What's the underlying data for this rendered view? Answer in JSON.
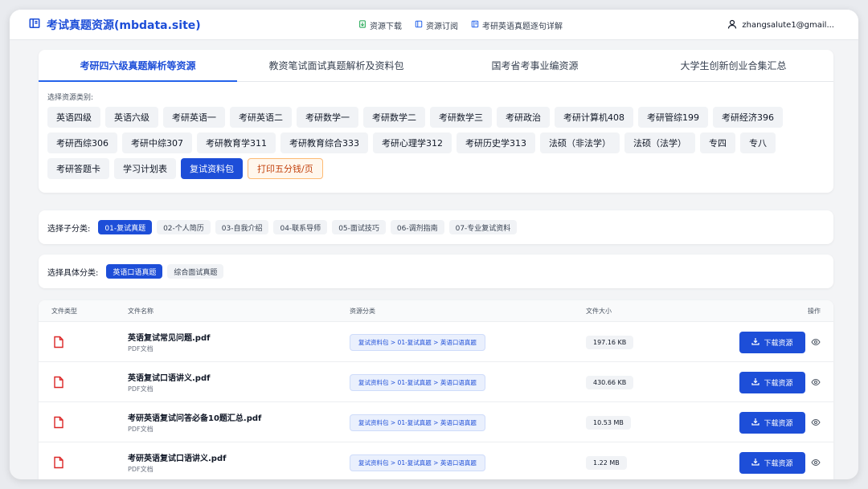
{
  "navbar": {
    "brand": "考试真题资源(mbdata.site)",
    "links": [
      "资源下载",
      "资源订阅",
      "考研英语真题逐句详解"
    ],
    "user": "zhangsalute1@gmail..."
  },
  "tabs": [
    "考研四六级真题解析等资源",
    "教资笔试面试真题解析及资料包",
    "国考省考事业编资源",
    "大学生创新创业合集汇总"
  ],
  "category_label": "选择资源类别:",
  "categories": [
    "英语四级",
    "英语六级",
    "考研英语一",
    "考研英语二",
    "考研数学一",
    "考研数学二",
    "考研数学三",
    "考研政治",
    "考研计算机408",
    "考研管综199",
    "考研经济396",
    "考研西综306",
    "考研中综307",
    "考研教育学311",
    "考研教育综合333",
    "考研心理学312",
    "考研历史学313",
    "法硕（非法学）",
    "法硕（法学）",
    "专四",
    "专八",
    "考研答题卡",
    "学习计划表",
    "复试资料包",
    "打印五分钱/页"
  ],
  "subcategory": {
    "label": "选择子分类:",
    "items": [
      "01-复试真题",
      "02-个人简历",
      "03-自我介绍",
      "04-联系导师",
      "05-面试技巧",
      "06-调剂指南",
      "07-专业复试资料"
    ]
  },
  "specific": {
    "label": "选择具体分类:",
    "items": [
      "英语口语真题",
      "综合面试真题"
    ]
  },
  "table": {
    "headers": [
      "文件类型",
      "文件名称",
      "资源分类",
      "文件大小",
      "操作"
    ],
    "download_label": "下载资源",
    "rows": [
      {
        "name": "英语复试常见问题.pdf",
        "type": "PDF文档",
        "path": "复试资料包 > 01-复试真题 > 英语口语真题",
        "size": "197.16 KB"
      },
      {
        "name": "英语复试口语讲义.pdf",
        "type": "PDF文档",
        "path": "复试资料包 > 01-复试真题 > 英语口语真题",
        "size": "430.66 KB"
      },
      {
        "name": "考研英语复试问答必备10题汇总.pdf",
        "type": "PDF文档",
        "path": "复试资料包 > 01-复试真题 > 英语口语真题",
        "size": "10.53 MB"
      },
      {
        "name": "考研英语复试口语讲义.pdf",
        "type": "PDF文档",
        "path": "复试资料包 > 01-复试真题 > 英语口语真题",
        "size": "1.22 MB"
      }
    ]
  },
  "colors": {
    "primary": "#1d4ed8",
    "pdf": "#dc2626",
    "print_text": "#c2410c"
  }
}
